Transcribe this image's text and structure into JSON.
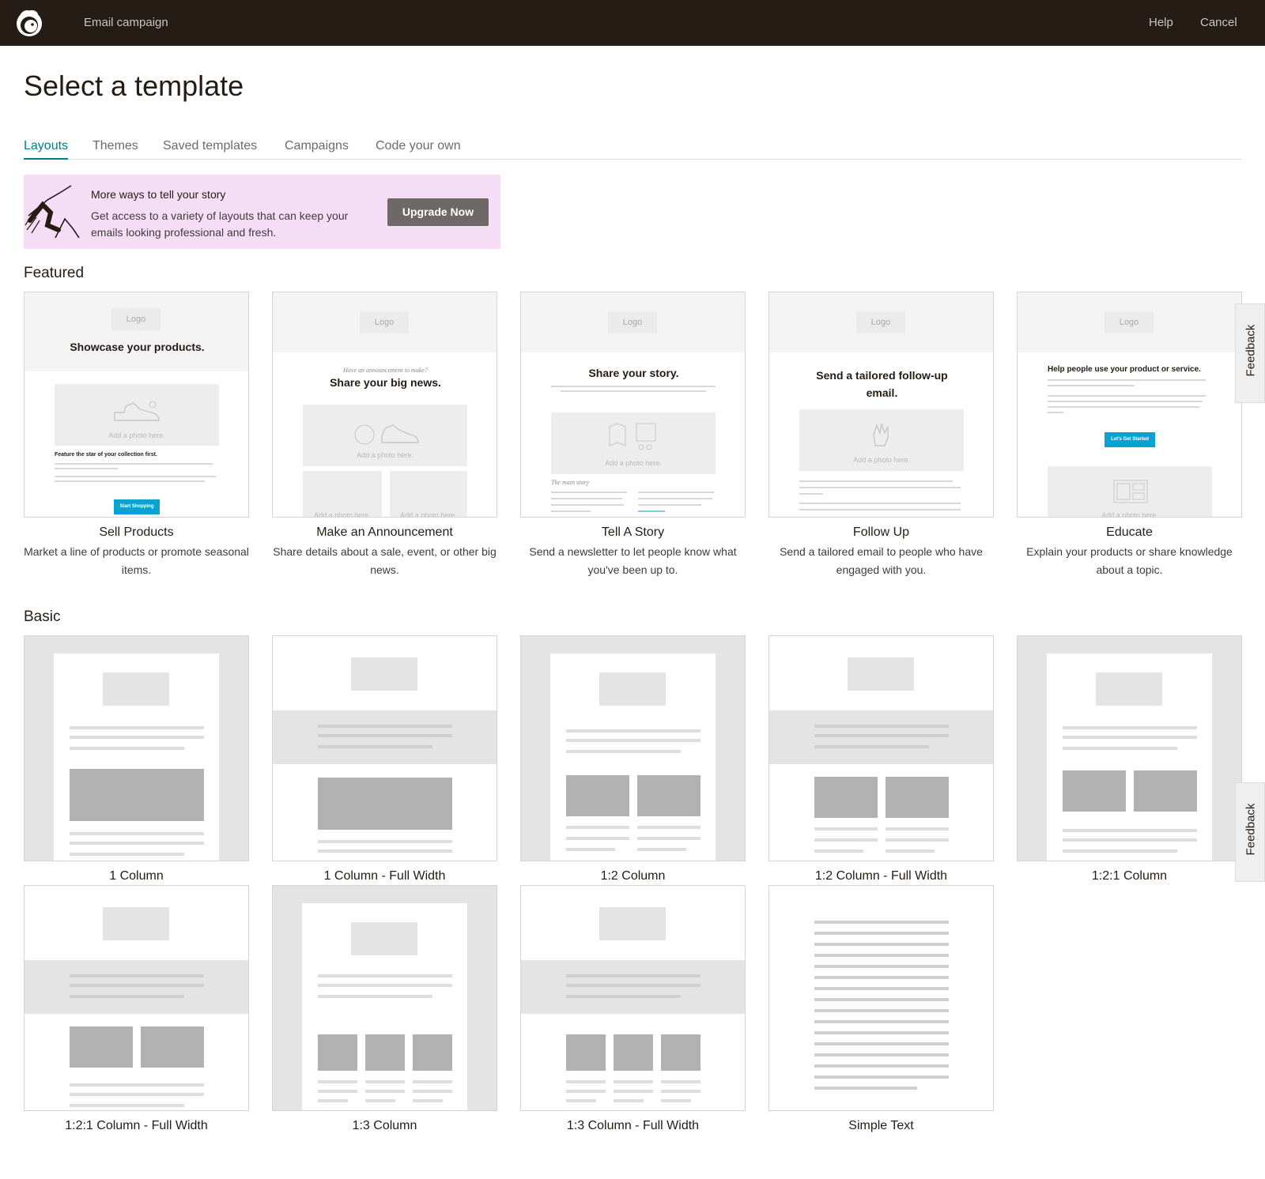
{
  "header": {
    "app_name": "Email campaign",
    "help_label": "Help",
    "cancel_label": "Cancel"
  },
  "page_title": "Select a template",
  "tabs": [
    {
      "label": "Layouts",
      "active": true
    },
    {
      "label": "Themes",
      "active": false
    },
    {
      "label": "Saved templates",
      "active": false
    },
    {
      "label": "Campaigns",
      "active": false
    },
    {
      "label": "Code your own",
      "active": false
    }
  ],
  "promo": {
    "title": "More ways to tell your story",
    "description": "Get access to a variety of layouts that can keep your emails looking professional and fresh.",
    "button_label": "Upgrade Now"
  },
  "featured": {
    "heading": "Featured",
    "cards": [
      {
        "title": "Sell Products",
        "description": "Market a line of products or promote seasonal items.",
        "preview_logo": "Logo",
        "preview_heading": "Showcase your products.",
        "preview_photo": "Add a photo here.",
        "preview_subhead": "Feature the star of your collection first.",
        "preview_cta": "Start Shopping"
      },
      {
        "title": "Make an Announcement",
        "description": "Share details about a sale, event, or other big news.",
        "preview_logo": "Logo",
        "preview_kicker": "Have an announcement to make?",
        "preview_heading": "Share your big news.",
        "preview_photo": "Add a photo here."
      },
      {
        "title": "Tell A Story",
        "description": "Send a newsletter to let people know what you've been up to.",
        "preview_logo": "Logo",
        "preview_heading": "Share your story.",
        "preview_photo": "Add a photo here.",
        "preview_kicker": "The main story"
      },
      {
        "title": "Follow Up",
        "description": "Send a tailored email to people who have engaged with you.",
        "preview_logo": "Logo",
        "preview_heading": "Send a tailored follow-up email.",
        "preview_photo": "Add a photo here."
      },
      {
        "title": "Educate",
        "description": "Explain your products or share knowledge about a topic.",
        "preview_logo": "Logo",
        "preview_heading": "Help people use your product or service.",
        "preview_photo": "Add a photo here.",
        "preview_cta": "Let's Get Started"
      }
    ]
  },
  "basic": {
    "heading": "Basic",
    "cards": [
      {
        "title": "1 Column"
      },
      {
        "title": "1 Column - Full Width"
      },
      {
        "title": "1:2 Column"
      },
      {
        "title": "1:2 Column - Full Width"
      },
      {
        "title": "1:2:1 Column"
      },
      {
        "title": "1:2:1 Column - Full Width"
      },
      {
        "title": "1:3 Column"
      },
      {
        "title": "1:3 Column - Full Width"
      },
      {
        "title": "Simple Text"
      }
    ]
  },
  "feedback_label": "Feedback",
  "colors": {
    "topbar": "#241c15",
    "accent": "#007c89",
    "promo_bg": "#f5ddf6",
    "upgrade_button": "#6e6967",
    "cta_blue": "#0aa3d1"
  },
  "icons": [
    "mailchimp-logo-icon",
    "climber-illustration-icon",
    "shoe-icon",
    "tag-icon",
    "hand-icon",
    "map-icon",
    "layout-icon"
  ]
}
